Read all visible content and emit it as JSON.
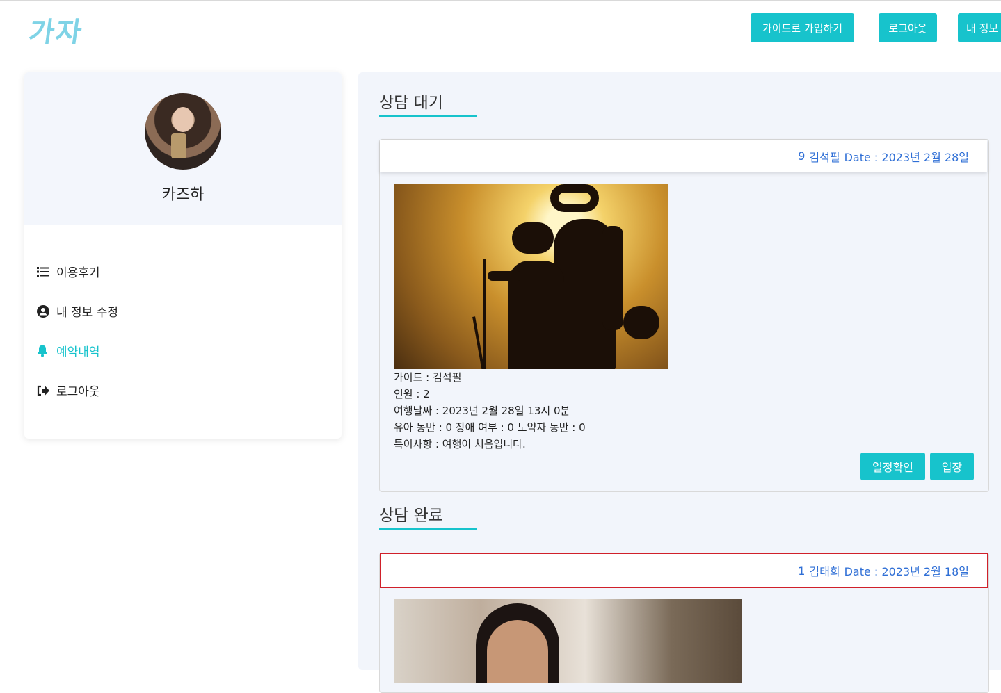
{
  "header": {
    "logo_text": "가자",
    "join_guide_label": "가이드로 가입하기",
    "logout_label": "로그아웃",
    "my_info_label": "내 정보"
  },
  "sidebar": {
    "profile_name": "카즈하",
    "items": [
      {
        "label": "이용후기",
        "icon": "list-icon"
      },
      {
        "label": "내 정보 수정",
        "icon": "user-circle-icon"
      },
      {
        "label": "예약내역",
        "icon": "bell-icon",
        "active": true
      },
      {
        "label": "로그아웃",
        "icon": "sign-out-icon"
      }
    ]
  },
  "waiting": {
    "title": "상담 대기",
    "card": {
      "number": "9",
      "guide": "김석필",
      "date": "Date : 2023년 2월 28일",
      "lines": [
        "가이드 : 김석필",
        "인원 : 2",
        "여행날짜 : 2023년 2월 28일 13시 0분",
        "유아 동반 : 0 장애 여부 : 0 노약자 동반 : 0",
        "특이사항 : 여행이 처음입니다."
      ],
      "schedule_button": "일정확인",
      "enter_button": "입장"
    }
  },
  "done": {
    "title": "상담 완료",
    "card": {
      "number": "1",
      "guide": "김태희",
      "date": "Date : 2023년 2월 18일"
    }
  },
  "colors": {
    "accent": "#17c3cc",
    "link": "#2f6fd6",
    "highlight_border": "#d0202a"
  }
}
